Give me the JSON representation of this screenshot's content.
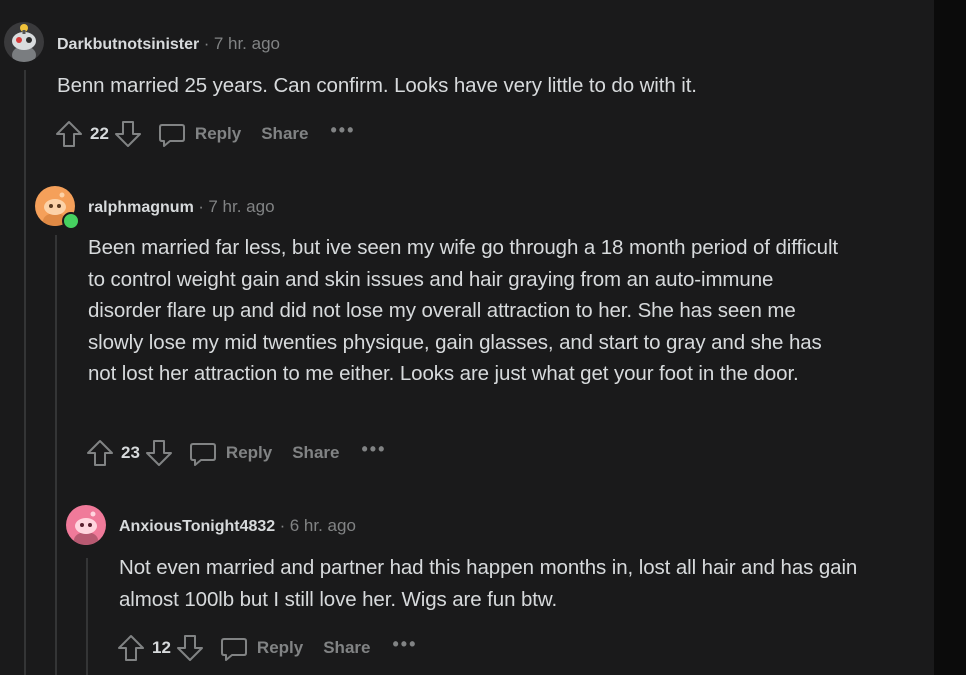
{
  "comments": [
    {
      "author": "Darkbutnotsinister",
      "separator": "·",
      "time": "7 hr. ago",
      "body": "Benn married 25 years. Can confirm. Looks have very little to do with it.",
      "score": "22",
      "reply_label": "Reply",
      "share_label": "Share",
      "more_label": "•••"
    },
    {
      "author": "ralphmagnum",
      "separator": "·",
      "time": "7 hr. ago",
      "body": "Been married far less, but ive seen my wife go through a 18 month period of difficult to control weight gain and skin issues and hair graying from an auto-immune disorder flare up and did not lose my overall attraction to her. She has seen me slowly lose my mid twenties physique, gain glasses, and start to gray and she has not lost her attraction to me either. Looks are just what get your foot in the door.",
      "score": "23",
      "reply_label": "Reply",
      "share_label": "Share",
      "more_label": "•••"
    },
    {
      "author": "AnxiousTonight4832",
      "separator": "·",
      "time": "6 hr. ago",
      "body": "Not even married and partner had this happen months in, lost all hair and has gain almost 100lb but I still love her. Wigs are fun btw.",
      "score": "12",
      "reply_label": "Reply",
      "share_label": "Share",
      "more_label": "•••"
    }
  ],
  "colors": {
    "background": "#1a1a1b",
    "online_indicator": "#46d160",
    "avatar1_bg": "#3a3a3c",
    "avatar2_bg": "#f5a05a",
    "avatar3_bg": "#f07a9a"
  }
}
